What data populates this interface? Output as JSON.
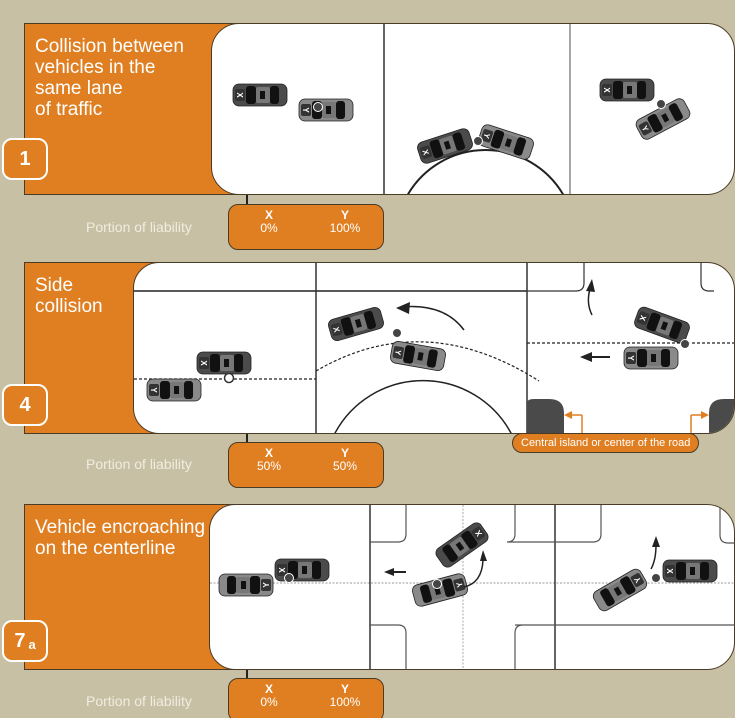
{
  "colors": {
    "background": "#c8c0a4",
    "accent_orange": "#e07f22",
    "scene_bg": "#ffffff",
    "car_x": "#4b4b4b",
    "car_y": "#8a8a8a"
  },
  "cases": [
    {
      "number": "1",
      "suffix": "",
      "title": "Collision between\nvehicles in the\nsame lane\nof traffic",
      "liability_label": "Portion of liability",
      "liability": [
        {
          "party": "X",
          "percent": "0%"
        },
        {
          "party": "Y",
          "percent": "100%"
        }
      ],
      "frames": [
        "rear-end straight",
        "rear-end on curve",
        "rear-end while turning"
      ]
    },
    {
      "number": "4",
      "suffix": "",
      "title": "Side\ncollision",
      "liability_label": "Portion of liability",
      "liability": [
        {
          "party": "X",
          "percent": "50%"
        },
        {
          "party": "Y",
          "percent": "50%"
        }
      ],
      "frames": [
        "side-swipe straight",
        "side-swipe on curve",
        "side collision at intersection"
      ],
      "note": "Central island or center of the road"
    },
    {
      "number": "7",
      "suffix": "a",
      "title": "Vehicle encroaching\non the centerline",
      "liability_label": "Portion of liability",
      "liability": [
        {
          "party": "X",
          "percent": "0%"
        },
        {
          "party": "Y",
          "percent": "100%"
        }
      ],
      "frames": [
        "head-on over centerline",
        "intersection encroachment",
        "turning across centerline"
      ]
    }
  ],
  "car_labels": {
    "x": "X",
    "y": "Y"
  }
}
